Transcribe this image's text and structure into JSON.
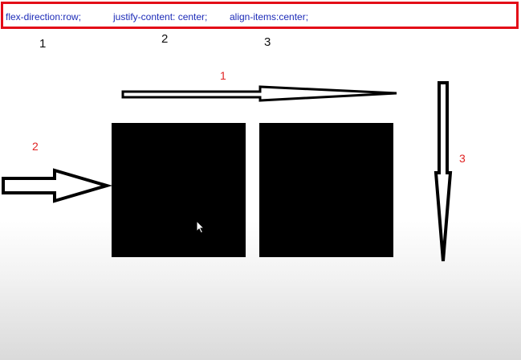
{
  "code_line": {
    "flex_direction": "flex-direction:row;",
    "justify_content": "justify-content: center;",
    "align_items": "align-items:center;"
  },
  "top_numbers": [
    "1",
    "2",
    "3"
  ],
  "annotations": {
    "arrow_1_label": "1",
    "arrow_2_label": "2",
    "arrow_3_label": "3",
    "label_color": "#e02424"
  },
  "colors": {
    "border": "#e30b17",
    "code_text": "#1c2bb8",
    "box_fill": "#000000"
  },
  "icons": {
    "arrow_1": "right-arrow-icon",
    "arrow_2": "right-arrow-icon",
    "arrow_3": "down-arrow-icon",
    "cursor": "mouse-cursor-icon"
  }
}
